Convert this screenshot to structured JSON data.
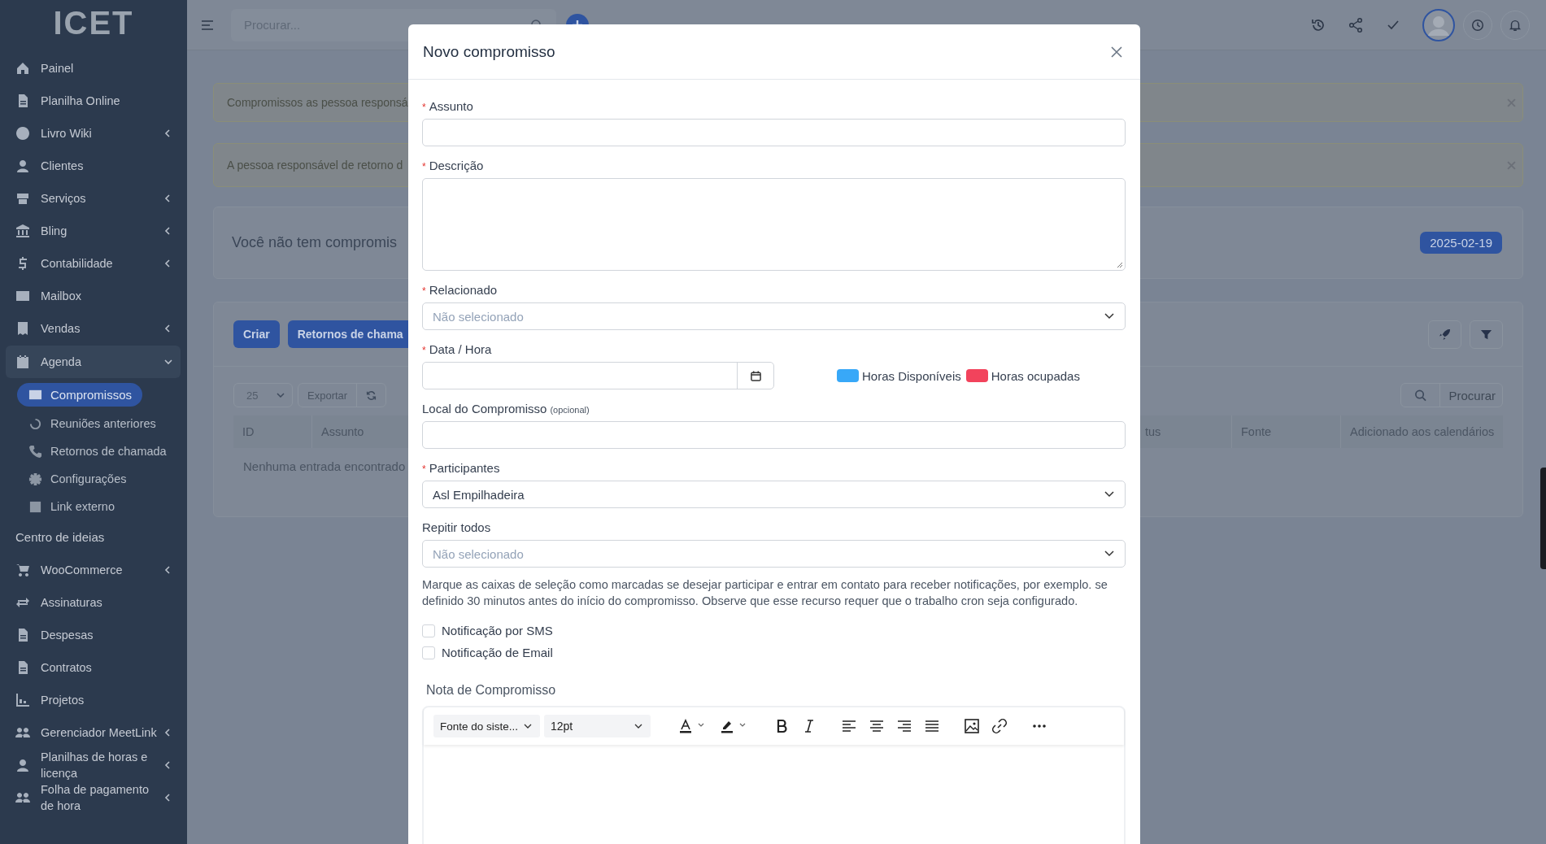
{
  "sidebar": {
    "logo": "ICET",
    "items": [
      {
        "kind": "link",
        "label": "Painel",
        "submenu": false
      },
      {
        "kind": "link",
        "label": "Planilha Online",
        "submenu": false
      },
      {
        "kind": "link",
        "label": "Livro Wiki",
        "submenu": true,
        "expanded": false
      },
      {
        "kind": "link",
        "label": "Clientes",
        "submenu": false
      },
      {
        "kind": "link",
        "label": "Serviços",
        "submenu": true,
        "expanded": false
      },
      {
        "kind": "link",
        "label": "Bling",
        "submenu": true,
        "expanded": false
      },
      {
        "kind": "link",
        "label": "Contabilidade",
        "submenu": true,
        "expanded": false
      },
      {
        "kind": "link",
        "label": "Mailbox",
        "submenu": false
      },
      {
        "kind": "link",
        "label": "Vendas",
        "submenu": true,
        "expanded": false
      },
      {
        "kind": "link",
        "label": "Agenda",
        "submenu": true,
        "expanded": true,
        "children": [
          {
            "label": "Compromissos",
            "selected": true
          },
          {
            "label": "Reuniões anteriores",
            "selected": false
          },
          {
            "label": "Retornos de chamada",
            "selected": false
          },
          {
            "label": "Configurações",
            "selected": false
          },
          {
            "label": "Link externo",
            "selected": false
          }
        ]
      },
      {
        "kind": "section",
        "label": "Centro de ideias"
      },
      {
        "kind": "link",
        "label": "WooCommerce",
        "submenu": true,
        "expanded": false
      },
      {
        "kind": "link",
        "label": "Assinaturas",
        "submenu": false
      },
      {
        "kind": "link",
        "label": "Despesas",
        "submenu": false
      },
      {
        "kind": "link",
        "label": "Contratos",
        "submenu": false
      },
      {
        "kind": "link",
        "label": "Projetos",
        "submenu": false
      },
      {
        "kind": "link",
        "label": "Gerenciador MeetLink",
        "submenu": true,
        "expanded": false
      },
      {
        "kind": "link",
        "label": "Planilhas de horas e licença",
        "submenu": true,
        "expanded": false
      },
      {
        "kind": "link",
        "label": "Folha de pagamento de hora",
        "submenu": true,
        "expanded": false
      }
    ]
  },
  "topbar": {
    "search": {
      "placeholder": "Procurar..."
    }
  },
  "alerts": [
    "Compromissos as pessoa responsá",
    "A pessoa responsável de retorno d"
  ],
  "summary": {
    "text": "Você não tem compromis",
    "date": "2025-02-19"
  },
  "table_panel": {
    "buttons": [
      "Criar",
      "Retornos de chama"
    ],
    "page_size": "25",
    "export": "Exportar",
    "search": {
      "placeholder": "Procurar"
    },
    "columns": [
      "ID",
      "Assunto",
      "tus",
      "Fonte",
      "Adicionado aos calendários"
    ],
    "empty": "Nenhuma entrada encontrado"
  },
  "modal": {
    "title": "Novo compromisso",
    "fields": [
      {
        "kind": "text",
        "label": "Assunto",
        "marker": "*"
      },
      {
        "kind": "textarea",
        "label": "Descrição",
        "marker": "*"
      },
      {
        "kind": "select",
        "label": "Relacionado",
        "marker": "*",
        "placeholder": "Não selecionado"
      },
      {
        "kind": "datetime",
        "label": "Data / Hora",
        "marker": "*",
        "legend": [
          {
            "label": "Horas Disponíveis",
            "color": "#38a8f8"
          },
          {
            "label": "Horas ocupadas",
            "color": "#f2435c"
          }
        ]
      },
      {
        "kind": "text",
        "label": "Local do Compromisso",
        "note": "(opcional)"
      },
      {
        "kind": "select",
        "label": "Participantes",
        "marker": "*",
        "value": "Asl Empilhadeira"
      },
      {
        "kind": "select",
        "label": "Repitir todos",
        "placeholder": "Não selecionado"
      }
    ],
    "help": "Marque as caixas de seleção como marcadas se desejar participar e entrar em contato para receber notificações, por exemplo. se definido 30 minutos antes do início do compromisso. Observe que esse recurso requer que o trabalho cron seja configurado.",
    "checkboxes": [
      {
        "label": "Notificação por SMS",
        "checked": false
      },
      {
        "label": "Notificação de Email",
        "checked": false
      }
    ],
    "editor": {
      "label": "Nota de Compromisso",
      "font": "Fonte do siste...",
      "size": "12pt"
    }
  }
}
